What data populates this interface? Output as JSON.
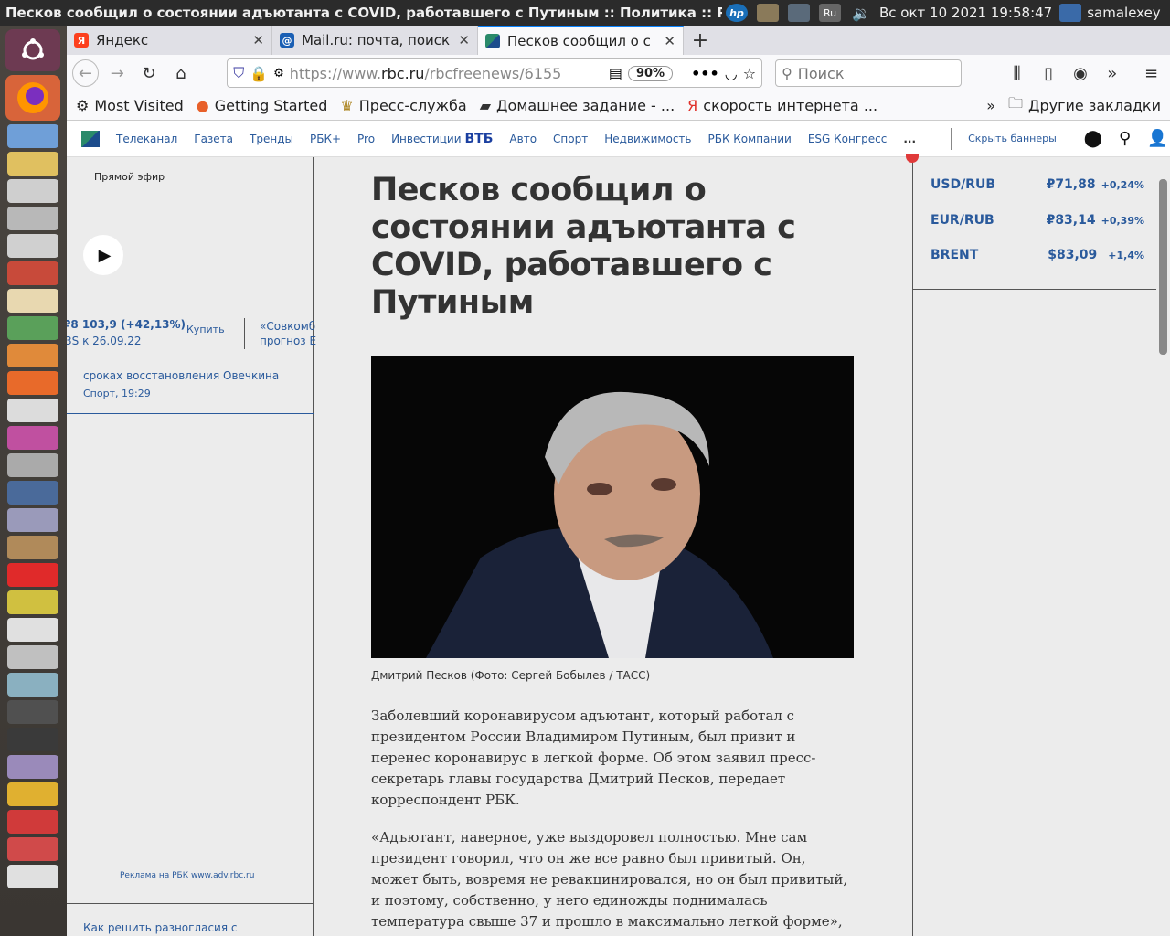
{
  "system": {
    "window_title": "Песков сообщил о состоянии адъютанта с COVID, работавшего с Путиным :: Политика :: РБК",
    "clock": "Вс окт 10 2021 19:58:47",
    "user": "samalexey",
    "lang_indicator": "Ru"
  },
  "tabs": [
    {
      "label": "Яндекс",
      "icon": "Я",
      "color": "#fc3f1d"
    },
    {
      "label": "Mail.ru: почта, поиск",
      "icon": "@",
      "color": "#1a5fb4"
    },
    {
      "label": "Песков сообщил о с",
      "icon": "rbc",
      "color": "#2a8a6a"
    }
  ],
  "navbar": {
    "url_prefix": "https://www.",
    "url_domain": "rbc.ru",
    "url_rest": "/rbcfreenews/6155",
    "zoom": "90%",
    "search_placeholder": "Поиск"
  },
  "bookmarks": [
    {
      "label": "Most Visited",
      "icon": "gear-icon"
    },
    {
      "label": "Getting Started",
      "icon": "firefox-icon"
    },
    {
      "label": "Пресс-служба",
      "icon": "eagle-icon"
    },
    {
      "label": "Домашнее задание - ...",
      "icon": "cap-icon"
    },
    {
      "label": "скорость интернета ...",
      "icon": "yandex-icon"
    }
  ],
  "bookmarks_other": "Другие закладки",
  "rbc_nav": {
    "items": [
      "Телеканал",
      "Газета",
      "Тренды",
      "РБК+",
      "Pro",
      "Инвестиции"
    ],
    "vtb": "ВТБ",
    "items2": [
      "Авто",
      "Спорт",
      "Недвижимость",
      "РБК Компании",
      "ESG Конгресс"
    ],
    "more": "...",
    "hide_banners": "Скрыть баннеры"
  },
  "left": {
    "live": "Прямой эфир",
    "ticker_value": "₽8 103,9",
    "ticker_change": "(+42,13%)",
    "ticker_sub": "3S к 26.09.22",
    "buy": "Купить",
    "promo_title": "«Совкомб",
    "promo_sub": "прогноз Е",
    "news_title": "сроках восстановления Овечкина",
    "news_meta": "Спорт, 19:29",
    "ad": "Реклама на РБК www.adv.rbc.ru",
    "bottom_link": "Как решить разногласия с"
  },
  "right": {
    "rates": [
      {
        "name": "USD/RUB",
        "value": "₽71,88",
        "change": "+0,24%"
      },
      {
        "name": "EUR/RUB",
        "value": "₽83,14",
        "change": "+0,39%"
      },
      {
        "name": "BRENT",
        "value": "$83,09",
        "change": "+1,4%"
      }
    ]
  },
  "article": {
    "headline": "Песков сообщил о состоянии адъютанта с COVID, работавшего с Путиным",
    "caption": "Дмитрий Песков (Фото: Сергей Бобылев / ТАСС)",
    "p1": "Заболевший коронавирусом адъютант, который работал с президентом России Владимиром Путиным, был привит и перенес коронавирус в легкой форме. Об этом заявил пресс-секретарь главы государства Дмитрий Песков, передает корреспондент РБК.",
    "p2": "«Адъютант, наверное, уже выздоровел полностью. Мне сам президент говорил, что он же все равно был привитый. Он, может быть, вовремя не ревакцинировался, но он был привитый, и поэтому, собственно, у него единожды поднималась температура свыше 37 и прошло в максимально легкой форме», — пояснил Песков."
  }
}
